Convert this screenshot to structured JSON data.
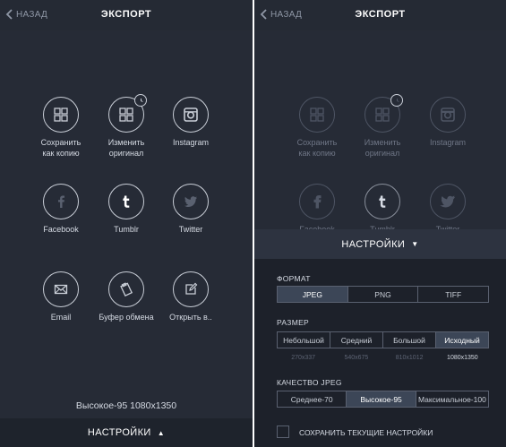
{
  "left": {
    "back_label": "НАЗАД",
    "title": "ЭКСПОРТ",
    "items": [
      {
        "label": "Сохранить\nкак копию"
      },
      {
        "label": "Изменить\nоригинал"
      },
      {
        "label": "Instagram"
      },
      {
        "label": "Facebook"
      },
      {
        "label": "Tumblr"
      },
      {
        "label": "Twitter"
      },
      {
        "label": "Email"
      },
      {
        "label": "Буфер обмена"
      },
      {
        "label": "Открыть в.."
      }
    ],
    "status": "Высокое-95   1080x1350",
    "settings_label": "НАСТРОЙКИ",
    "settings_arrow": "▲"
  },
  "right": {
    "back_label": "НАЗАД",
    "title": "ЭКСПОРТ",
    "items": [
      {
        "label": "Сохранить\nкак копию"
      },
      {
        "label": "Изменить\nоригинал"
      },
      {
        "label": "Instagram"
      },
      {
        "label": "Facebook"
      },
      {
        "label": "Tumblr"
      },
      {
        "label": "Twitter"
      }
    ],
    "panel": {
      "header_label": "НАСТРОЙКИ",
      "header_arrow": "▼",
      "format_label": "ФОРМАТ",
      "formats": [
        "JPEG",
        "PNG",
        "TIFF"
      ],
      "format_selected": "JPEG",
      "size_label": "РАЗМЕР",
      "sizes": [
        "Небольшой",
        "Средний",
        "Большой",
        "Исходный"
      ],
      "size_values": [
        "270x337",
        "540x675",
        "810x1012",
        "1080x1350"
      ],
      "size_selected": "Исходный",
      "quality_label": "КАЧЕСТВО JPEG",
      "qualities": [
        "Среднее-70",
        "Высокое-95",
        "Максимальное-100"
      ],
      "quality_selected": "Высокое-95",
      "save_settings_label": "СОХРАНИТЬ ТЕКУЩИЕ НАСТРОЙКИ",
      "save_settings_checked": false
    }
  },
  "icons": [
    "grid-icon",
    "grid-clock-icon",
    "instagram-icon",
    "facebook-icon",
    "tumblr-icon",
    "twitter-icon",
    "email-icon",
    "clipboard-icon",
    "open-in-icon"
  ],
  "colors": {
    "background": "#262b36",
    "panel": "#1d212a",
    "active_segment": "#3c4657",
    "text": "#d5dae3"
  }
}
